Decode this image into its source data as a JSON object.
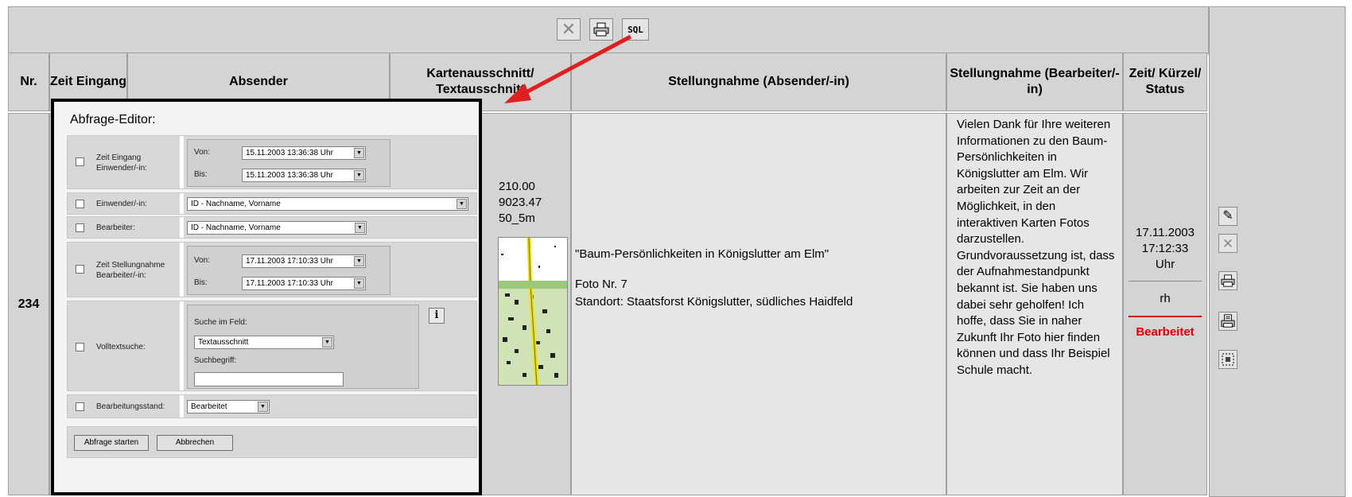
{
  "toolbar": {
    "close_icon": "close-icon",
    "print_icon": "printer-icon",
    "sql_label": "SQL"
  },
  "headers": {
    "nr": "Nr.",
    "zeit_eingang": "Zeit Eingang",
    "absender": "Absender",
    "kartenausschnitt": "Kartenausschnitt/ Textausschnitt",
    "stellungnahme_absender": "Stellungnahme (Absender/-in)",
    "stellungnahme_bearbeiter": "Stellungnahme (Bearbeiter/-in)",
    "zeit_kuerzel_status": "Zeit/ Kürzel/ Status"
  },
  "row": {
    "nr": "234",
    "map_coords": [
      "210.00",
      "9023.47",
      "50_5m"
    ],
    "stellungnahme_absender": {
      "title": "\"Baum-Persönlichkeiten in Königslutter am Elm\"",
      "foto": "Foto Nr. 7",
      "standort": "Standort: Staatsforst Königslutter, südliches Haidfeld"
    },
    "stellungnahme_bearbeiter": "Vielen Dank für Ihre weiteren Informationen zu den Baum-Persönlichkeiten in Königslutter am Elm. Wir arbeiten zur Zeit an der Möglichkeit, in den interaktiven Karten Fotos darzustellen. Grundvoraussetzung ist, dass der Aufnahmestandpunkt bekannt ist. Sie haben uns dabei sehr geholfen! Ich hoffe, dass Sie in naher Zukunft Ihr Foto hier finden können und dass Ihr Beispiel Schule macht.",
    "date": "17.11.2003",
    "time": "17:12:33",
    "time_unit": "Uhr",
    "kuerzel": "rh",
    "status": "Bearbeitet",
    "status_color": "#e00000"
  },
  "side_icons": [
    "edit-icon",
    "close-icon",
    "printer-icon",
    "print-preview-icon",
    "select-area-icon"
  ],
  "editor": {
    "title": "Abfrage-Editor:",
    "zeit_eingang_label": "Zeit Eingang Einwender/-in:",
    "von_label": "Von:",
    "bis_label": "Bis:",
    "zeit_eingang_von": "15.11.2003 13:36:38 Uhr",
    "zeit_eingang_bis": "15.11.2003 13:36:38 Uhr",
    "einwender_label": "Einwender/-in:",
    "einwender_value": "ID - Nachname, Vorname",
    "bearbeiter_label": "Bearbeiter:",
    "bearbeiter_value": "ID - Nachname, Vorname",
    "zeit_stellungnahme_label": "Zeit Stellungnahme Bearbeiter/-in:",
    "zeit_stellungnahme_von": "17.11.2003 17:10:33 Uhr",
    "zeit_stellungnahme_bis": "17.11.2003 17:10:33 Uhr",
    "volltext_label": "Volltextsuche:",
    "suche_im_feld_label": "Suche im Feld:",
    "suche_im_feld_value": "Textausschnitt",
    "suchbegriff_label": "Suchbegriff:",
    "suchbegriff_value": "",
    "info_label": "i",
    "bearbeitungsstand_label": "Bearbeitungsstand:",
    "bearbeitungsstand_value": "Bearbeitet",
    "start_button": "Abfrage starten",
    "cancel_button": "Abbrechen"
  },
  "colors": {
    "arrow": "#e02020",
    "header_bg": "#d4d4d4",
    "status": "#e00000"
  }
}
